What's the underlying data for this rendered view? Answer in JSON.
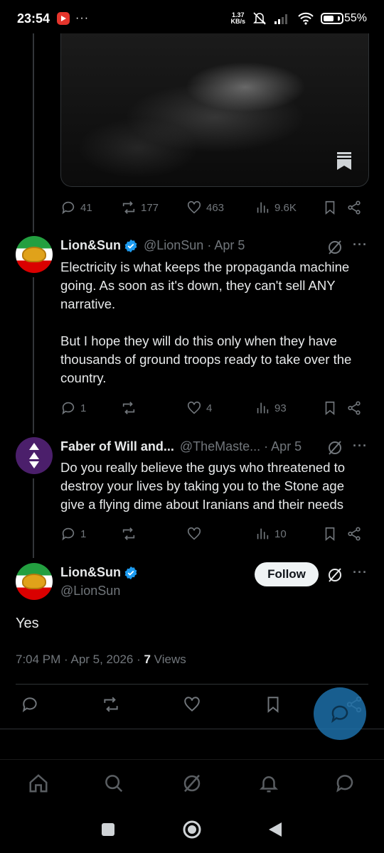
{
  "status_bar": {
    "time": "23:54",
    "dots": "···",
    "net_speed_value": "1.37",
    "net_speed_unit": "KB/s",
    "battery": "55%"
  },
  "tweet0_actions": {
    "replies": "41",
    "reposts": "177",
    "likes": "463",
    "views": "9.6K"
  },
  "tweet1": {
    "name": "Lion&Sun",
    "handle": "@LionSun · Apr 5",
    "text_p1": "Electricity is what keeps the propaganda machine going. As soon as it's down, they can't sell ANY narrative.",
    "text_p2": "But I hope they will do this only when they have thousands of ground troops ready to take over the country.",
    "replies": "1",
    "reposts": "",
    "likes": "4",
    "views": "93"
  },
  "tweet2": {
    "name": "Faber of Will and...",
    "handle": "@TheMaste... · Apr 5",
    "text": "Do you really believe the guys who threatened to destroy your lives by taking you to the Stone age give a flying dime about Iranians and their needs",
    "replies": "1",
    "reposts": "",
    "likes": "",
    "views": "10"
  },
  "main_tweet": {
    "name": "Lion&Sun",
    "handle": "@LionSun",
    "follow_label": "Follow",
    "text": "Yes",
    "timestamp": "7:04 PM · Apr 5, 2026 · ",
    "views_count": "7",
    "views_label": " Views"
  },
  "colors": {
    "accent": "#1d9bf0",
    "muted": "#71767b",
    "text": "#e7e9ea",
    "background": "#000000"
  },
  "icons": [
    "reply-icon",
    "repost-icon",
    "like-icon",
    "views-icon",
    "bookmark-icon",
    "share-icon",
    "grok-icon",
    "verified-icon",
    "home-icon",
    "search-icon",
    "notifications-icon",
    "messages-icon"
  ]
}
